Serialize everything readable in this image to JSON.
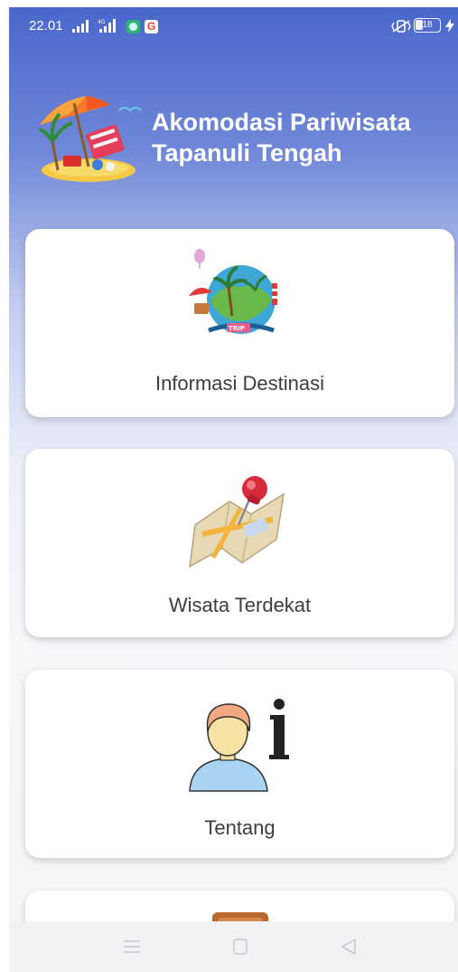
{
  "status_bar": {
    "time": "22.01",
    "battery": "18",
    "icons": [
      "signal-bars-icon",
      "signal-4g-icon",
      "app-notification-icon",
      "google-icon",
      "vibrate-icon",
      "battery-icon",
      "charging-icon"
    ]
  },
  "header": {
    "title_line1": "Akomodasi Pariwisata",
    "title_line2": "Tapanuli Tengah",
    "logo": "beach-chair-umbrella-logo"
  },
  "menu": [
    {
      "label": "Informasi Destinasi",
      "icon": "travel-globe-icon"
    },
    {
      "label": "Wisata Terdekat",
      "icon": "map-pin-icon"
    },
    {
      "label": "Tentang",
      "icon": "person-info-icon"
    },
    {
      "label": "",
      "icon": "suitcase-icon"
    }
  ],
  "nav_bar": {
    "icons": [
      "menu-icon",
      "home-icon",
      "back-icon"
    ]
  },
  "colors": {
    "header_gradient_top": "#4a67cc",
    "card_background": "#ffffff",
    "label_text": "#3d3d3d"
  }
}
